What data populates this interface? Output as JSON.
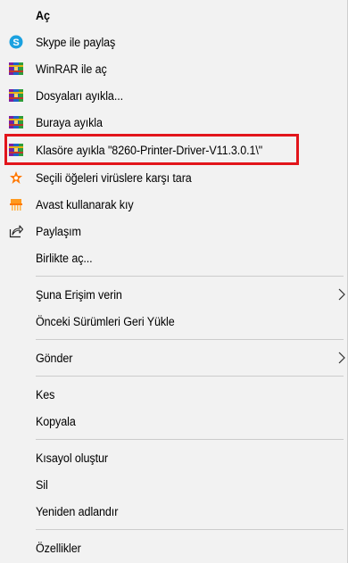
{
  "menu": {
    "items": [
      {
        "label": "Aç",
        "icon": "none",
        "bold": true
      },
      {
        "label": "Skype ile paylaş",
        "icon": "skype-icon"
      },
      {
        "label": "WinRAR ile aç",
        "icon": "winrar-icon"
      },
      {
        "label": "Dosyaları ayıkla...",
        "icon": "winrar-icon"
      },
      {
        "label": "Buraya ayıkla",
        "icon": "winrar-icon"
      },
      {
        "label": "Klasöre ayıkla \"8260-Printer-Driver-V11.3.0.1\\\"",
        "icon": "winrar-icon"
      },
      {
        "label": "Seçili öğeleri virüslere karşı tara",
        "icon": "avast-scan-icon"
      },
      {
        "label": "Avast kullanarak kıy",
        "icon": "avast-shredder-icon"
      },
      {
        "label": "Paylaşım",
        "icon": "share-icon"
      },
      {
        "label": "Birlikte aç...",
        "icon": "none"
      },
      {
        "label": "Şuna Erişim verin",
        "icon": "none",
        "submenu": true
      },
      {
        "label": "Önceki Sürümleri Geri Yükle",
        "icon": "none"
      },
      {
        "label": "Gönder",
        "icon": "none",
        "submenu": true
      },
      {
        "label": "Kes",
        "icon": "none"
      },
      {
        "label": "Kopyala",
        "icon": "none"
      },
      {
        "label": "Kısayol oluştur",
        "icon": "none"
      },
      {
        "label": "Sil",
        "icon": "none"
      },
      {
        "label": "Yeniden adlandır",
        "icon": "none"
      },
      {
        "label": "Özellikler",
        "icon": "none"
      }
    ]
  },
  "colors": {
    "menu_background": "#f2f2f2",
    "highlight_border": "#e2151b",
    "separator": "#cccccc",
    "skype_blue": "#1aa1e0",
    "avast_orange": "#ff7800"
  }
}
